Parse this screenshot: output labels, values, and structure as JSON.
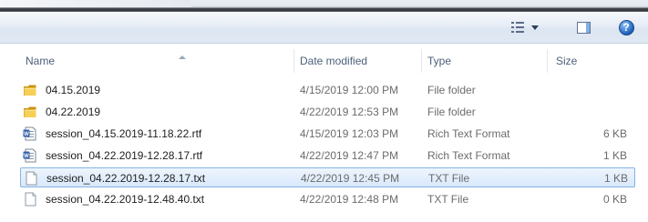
{
  "toolbar": {
    "views_icon": "change-view-icon",
    "preview_pane_icon": "preview-pane-icon",
    "help_icon": "help-icon",
    "help_glyph": "?"
  },
  "columns": {
    "name": "Name",
    "date": "Date modified",
    "type": "Type",
    "size": "Size"
  },
  "files": [
    {
      "name": "04.15.2019",
      "date": "4/15/2019 12:00 PM",
      "type": "File folder",
      "size": "",
      "icon": "folder-icon",
      "selected": false
    },
    {
      "name": "04.22.2019",
      "date": "4/22/2019 12:53 PM",
      "type": "File folder",
      "size": "",
      "icon": "folder-icon",
      "selected": false
    },
    {
      "name": "session_04.15.2019-11.18.22.rtf",
      "date": "4/15/2019 12:03 PM",
      "type": "Rich Text Format",
      "size": "6 KB",
      "icon": "rtf-document-icon",
      "selected": false
    },
    {
      "name": "session_04.22.2019-12.28.17.rtf",
      "date": "4/22/2019 12:47 PM",
      "type": "Rich Text Format",
      "size": "1 KB",
      "icon": "rtf-document-icon",
      "selected": false
    },
    {
      "name": "session_04.22.2019-12.28.17.txt",
      "date": "4/22/2019 12:45 PM",
      "type": "TXT File",
      "size": "1 KB",
      "icon": "text-file-icon",
      "selected": true
    },
    {
      "name": "session_04.22.2019-12.48.40.txt",
      "date": "4/22/2019 12:48 PM",
      "type": "TXT File",
      "size": "0 KB",
      "icon": "text-file-icon",
      "selected": false
    }
  ],
  "colors": {
    "selection_fill": "#d8e8fb",
    "selection_border": "#86b3e6",
    "header_text": "#4c607a"
  }
}
